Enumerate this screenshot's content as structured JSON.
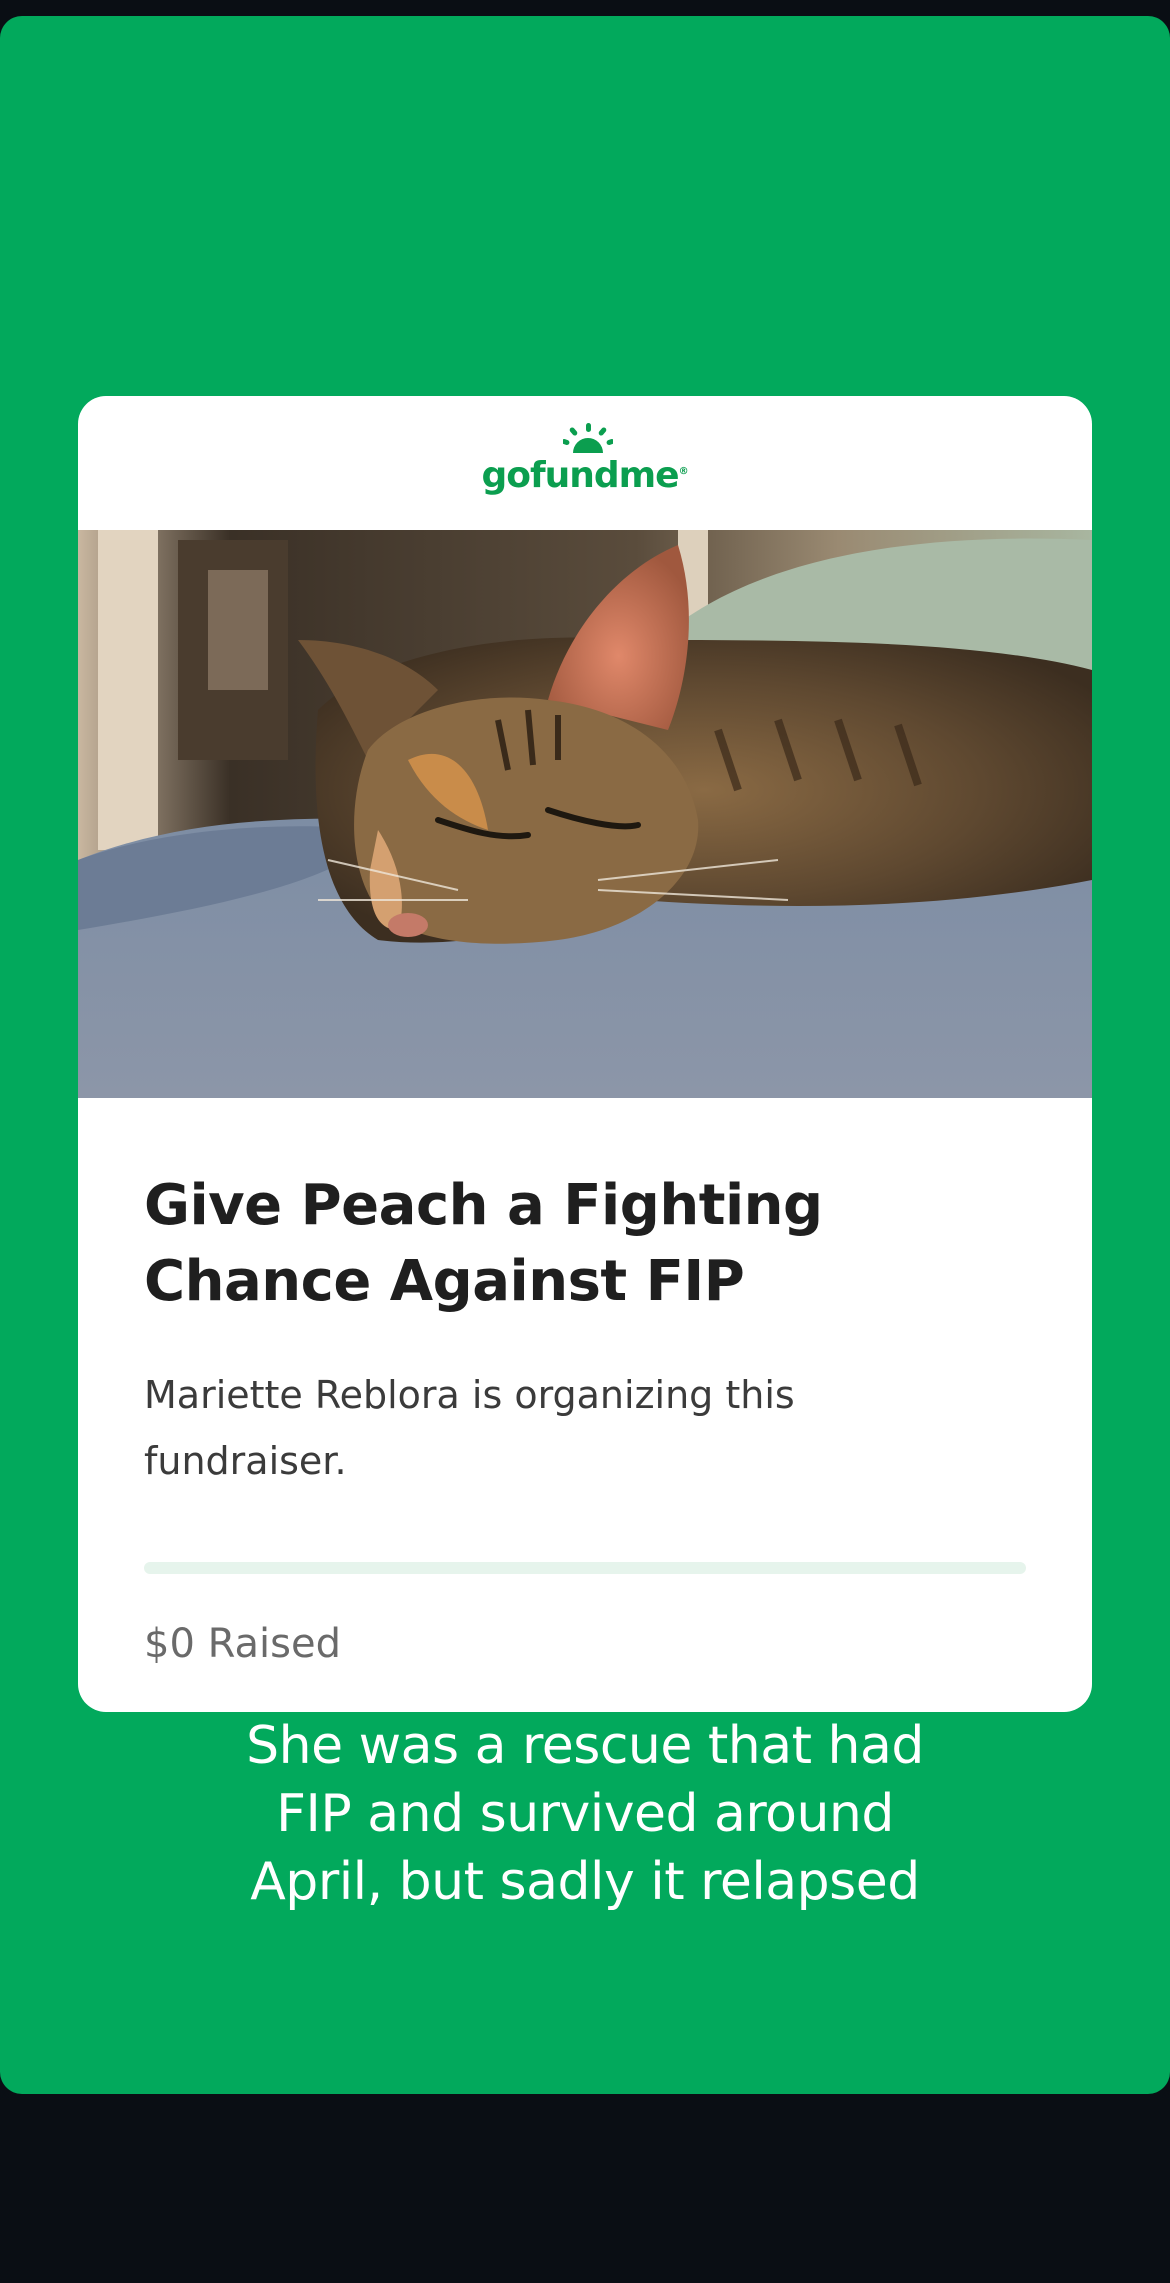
{
  "colors": {
    "page_background": "#0a0e14",
    "story_background": "#02a95c",
    "card_background": "#ffffff",
    "brand_green": "#0b9e4f",
    "caption_text": "#ffffff"
  },
  "card": {
    "logo": {
      "icon": "gofundme-sun-icon",
      "text": "gofundme"
    },
    "photo": {
      "icon": "cat-photo"
    },
    "title": "Give Peach a Fighting Chance Against FIP",
    "organizer": "Mariette Reblora is organizing this fundraiser.",
    "progress_fraction": 0,
    "raised_text": "$0 Raised"
  },
  "caption": {
    "lines": [
      "She was a rescue that had",
      "FIP and survived around",
      "April, but sadly it relapsed"
    ]
  }
}
